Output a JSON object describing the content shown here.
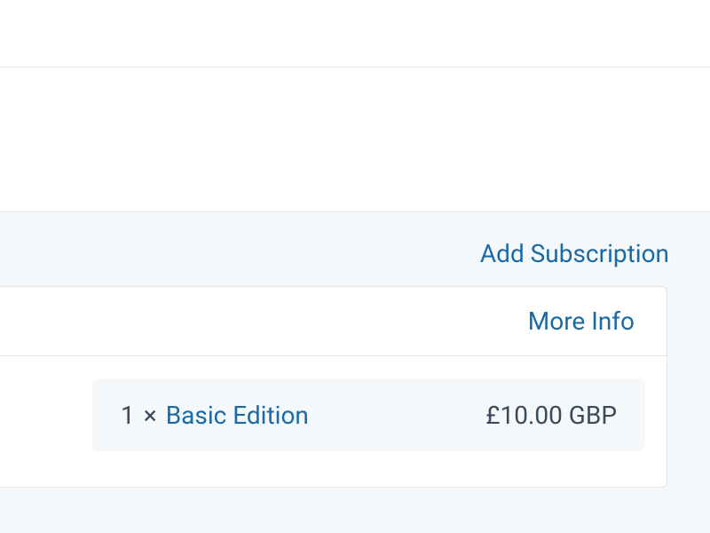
{
  "actions": {
    "add_subscription_label": "Add Subscription"
  },
  "subscription_card": {
    "more_info_label": "More Info",
    "line_item": {
      "quantity": "1",
      "times_symbol": "×",
      "product_name": "Basic Edition",
      "price": "£10.00 GBP"
    }
  }
}
